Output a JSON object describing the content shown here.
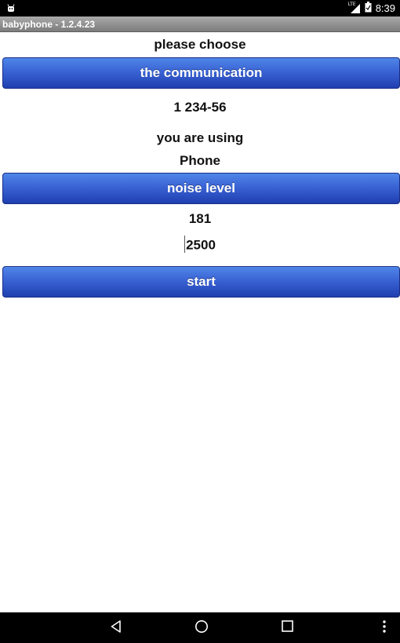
{
  "status_bar": {
    "time": "8:39",
    "network_label": "LTE",
    "icons": [
      "android-icon",
      "signal-icon",
      "battery-icon"
    ]
  },
  "app_title": "babyphone - 1.2.4.23",
  "main": {
    "choose_label": "please choose",
    "communication_button": "the communication",
    "phone_number": "1 234-56",
    "using_label": "you are using",
    "mode_value": "Phone",
    "noise_button": "noise level",
    "noise_value": "181",
    "threshold_value": "2500",
    "start_button": "start"
  },
  "nav_bar": {
    "icons": [
      "back-icon",
      "home-icon",
      "recents-icon",
      "overflow-menu-icon"
    ]
  },
  "colors": {
    "button_top": "#4f86e8",
    "button_bottom": "#1f3fb0",
    "titlebar": "#8f8f8f"
  }
}
